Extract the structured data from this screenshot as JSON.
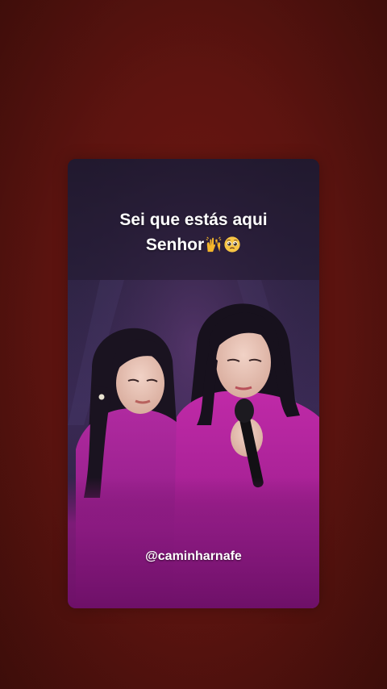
{
  "background": {
    "color": "#5a130f"
  },
  "post": {
    "caption_line1": "Sei que estás aqui",
    "caption_line2": "Senhor",
    "caption_emojis": [
      "raising-hands-icon",
      "pleading-face-icon"
    ],
    "watermark": "@caminharnafe"
  },
  "colors": {
    "outfit_magenta": "#a51e8e",
    "stage_purple": "#2a1f3d"
  }
}
